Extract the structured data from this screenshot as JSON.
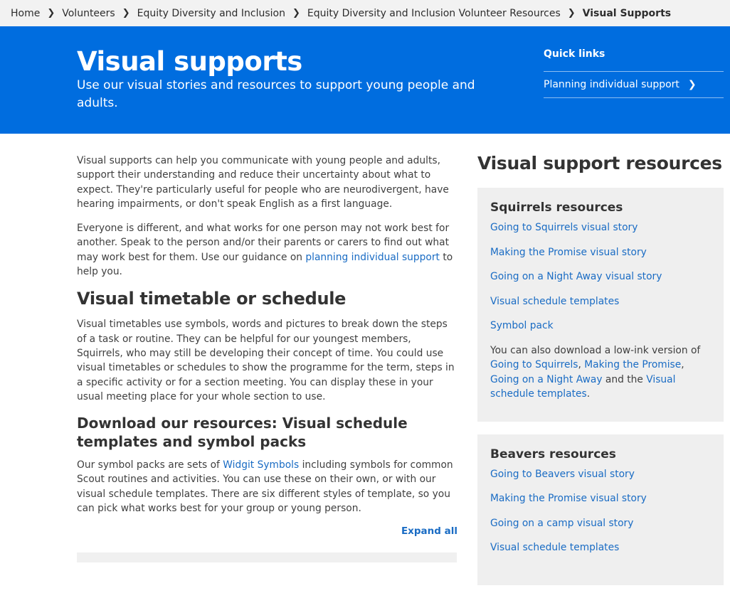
{
  "breadcrumb": {
    "items": [
      "Home",
      "Volunteers",
      "Equity Diversity and Inclusion",
      "Equity Diversity and Inclusion Volunteer Resources"
    ],
    "current": "Visual Supports"
  },
  "hero": {
    "title": "Visual supports",
    "subtitle": "Use our visual stories and resources to support young people and adults."
  },
  "quick_links": {
    "title": "Quick links",
    "items": [
      "Planning individual support"
    ]
  },
  "main": {
    "intro_p1": "Visual supports can help you communicate with young people and adults, support their understanding and reduce their uncertainty about what to expect. They're particularly useful for people who are neurodivergent, have hearing impairments, or don't speak English as a first language.",
    "intro_p2_before": "Everyone is different, and what works for one person may not work best for another. Speak to the person and/or their parents or carers to find out what may work best for them. Use our guidance on ",
    "intro_p2_link": "planning individual support",
    "intro_p2_after": " to help you.",
    "timetable_heading": "Visual timetable or schedule",
    "timetable_p": "Visual timetables use symbols, words and pictures to break down the steps of a task or routine. They can be helpful for our youngest members, Squirrels, who may still be developing their concept of time. You could use visual timetables or schedules to show the programme for the term, steps in a specific activity or for a section meeting. You can display these in your usual meeting place for your whole section to use.",
    "download_heading": "Download our resources: Visual schedule templates and symbol packs",
    "download_p_before": "Our symbol packs are sets of ",
    "download_p_link": "Widgit Symbols",
    "download_p_after": " including symbols for common Scout routines and activities. You can use these on their own, or with our visual schedule templates. There are six different styles of template, so you can pick what works best for your group or young person.",
    "expand_all": "Expand all"
  },
  "sidebar": {
    "title": "Visual support resources",
    "squirrels": {
      "title": "Squirrels resources",
      "links": [
        "Going to Squirrels visual story",
        "Making the Promise visual story",
        "Going on a Night Away visual story",
        "Visual schedule templates",
        "Symbol pack"
      ],
      "note_before": "You can also download a low-ink version of ",
      "note_link1": "Going to Squirrels",
      "note_sep1": ", ",
      "note_link2": "Making the Promise",
      "note_sep2": ", ",
      "note_link3": "Going on a Night Away",
      "note_mid": " and the ",
      "note_link4": "Visual schedule templates",
      "note_end": "."
    },
    "beavers": {
      "title": "Beavers resources",
      "links": [
        "Going to Beavers visual story",
        "Making the Promise visual story",
        "Going on a camp visual story",
        "Visual schedule templates"
      ]
    }
  },
  "colors": {
    "brand_blue": "#006ddf",
    "link": "#1a6cc4",
    "card_bg": "#efefef"
  }
}
